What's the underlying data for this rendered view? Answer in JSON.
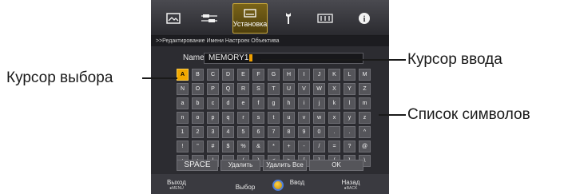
{
  "menu": {
    "tabs": [
      {
        "icon": "picture-adjust-icon"
      },
      {
        "icon": "input-signal-icon"
      },
      {
        "icon": "installation-icon",
        "label": "Установка",
        "active": true
      },
      {
        "icon": "function-wrench-icon"
      },
      {
        "icon": "information-display-icon"
      },
      {
        "icon": "info-icon"
      }
    ],
    "active_label": "Установка",
    "info_glyph": "i"
  },
  "breadcrumb": ">>Редактирование Имени Настроек Объектива",
  "name": {
    "label": "Name",
    "value": "MEMORY1"
  },
  "keyboard": {
    "rows": [
      [
        "A",
        "B",
        "C",
        "D",
        "E",
        "F",
        "G",
        "H",
        "I",
        "J",
        "K",
        "L",
        "M"
      ],
      [
        "N",
        "O",
        "P",
        "Q",
        "R",
        "S",
        "T",
        "U",
        "V",
        "W",
        "X",
        "Y",
        "Z"
      ],
      [
        "a",
        "b",
        "c",
        "d",
        "e",
        "f",
        "g",
        "h",
        "i",
        "j",
        "k",
        "l",
        "m"
      ],
      [
        "n",
        "o",
        "p",
        "q",
        "r",
        "s",
        "t",
        "u",
        "v",
        "w",
        "x",
        "y",
        "z"
      ],
      [
        "1",
        "2",
        "3",
        "4",
        "5",
        "6",
        "7",
        "8",
        "9",
        "0",
        ".",
        ".",
        "^"
      ],
      [
        "!",
        "\"",
        "#",
        "$",
        "%",
        "&",
        "*",
        "+",
        "-",
        "/",
        "=",
        "?",
        "@"
      ],
      [
        ":",
        ";",
        "|",
        "~",
        "(",
        ")",
        "<",
        ">",
        "[",
        "]",
        "{",
        "}",
        "\\"
      ]
    ],
    "selected": "A"
  },
  "actions": {
    "space": "SPACE",
    "delete": "Удалить",
    "delete_all": "Удалить Все",
    "ok": "OK"
  },
  "footer": {
    "exit": "Выход",
    "exit_key": "●MENU",
    "select": "Выбор",
    "enter": "Ввод",
    "back": "Назад",
    "back_key": "●BACK"
  },
  "callouts": {
    "selection_cursor": "Курсор выбора",
    "input_cursor": "Курсор ввода",
    "char_list": "Список символов"
  },
  "colors": {
    "accent": "#f0a800",
    "osd_bg": "#2c2c31",
    "key_bg": "#55555a"
  }
}
